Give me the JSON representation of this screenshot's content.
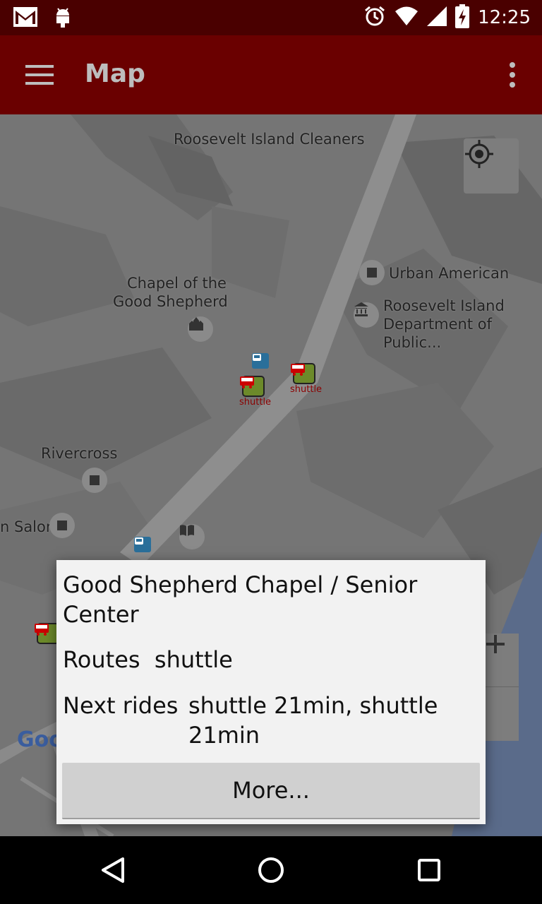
{
  "status_bar": {
    "time": "12:25",
    "icons": [
      "gmail-icon",
      "android-icon",
      "alarm-icon",
      "wifi-icon",
      "signal-icon",
      "battery-charging-icon"
    ]
  },
  "app_bar": {
    "title": "Map",
    "menu_icon": "hamburger-menu-icon",
    "overflow_icon": "overflow-menu-icon"
  },
  "map": {
    "labels": {
      "cleaners": "Roosevelt Island Cleaners",
      "chapel_line1": "Chapel of the",
      "chapel_line2": "Good Shepherd",
      "urban": "Urban American",
      "dept_line1": "Roosevelt Island",
      "dept_line2": "Department of Public...",
      "rivercross": "Rivercross",
      "salon": "n Salon"
    },
    "shuttle_label": "shuttle",
    "google_logo": "Goo"
  },
  "dialog": {
    "stop_name": "Good Shepherd Chapel / Senior Center",
    "routes_label": "Routes",
    "routes_value": "shuttle",
    "next_label": "Next rides",
    "next_value": "shuttle 21min, shuttle 21min",
    "more_button": "More..."
  },
  "colors": {
    "status_bar": "#4a0000",
    "app_bar": "#6a0000",
    "dialog_bg": "#f2f2f2",
    "shuttle_label": "#8b0000"
  }
}
